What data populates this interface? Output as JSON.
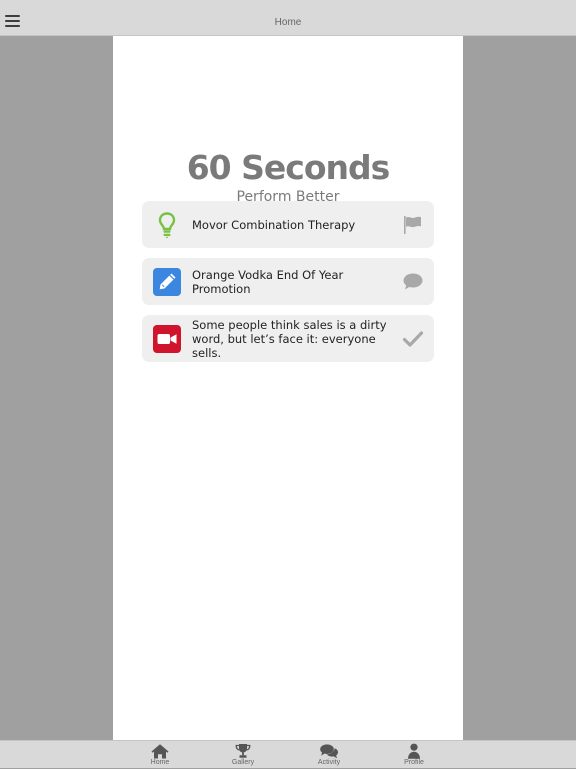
{
  "header": {
    "title": "Home",
    "menu_icon": "hamburger-menu-icon"
  },
  "brand": {
    "title": "60 Seconds",
    "subtitle": "Perform Better"
  },
  "cards": [
    {
      "text": "Movor Combination Therapy",
      "icon": "lightbulb-icon",
      "icon_color": "#7ac143",
      "action_icon": "flag-icon"
    },
    {
      "text": "Orange Vodka End Of Year Promotion",
      "icon": "pencil-icon",
      "icon_color": "#3b87e0",
      "action_icon": "comment-icon"
    },
    {
      "text": "Some people think sales is a dirty word, but let’s face it: everyone sells.",
      "icon": "video-camera-icon",
      "icon_color": "#d0142c",
      "action_icon": "checkmark-icon"
    }
  ],
  "tabbar": {
    "tabs": [
      {
        "label": "Home",
        "icon": "home-icon"
      },
      {
        "label": "Gallery",
        "icon": "trophy-icon"
      },
      {
        "label": "Activity",
        "icon": "chat-bubbles-icon"
      },
      {
        "label": "Profile",
        "icon": "person-icon"
      }
    ]
  },
  "colors": {
    "background": "#a0a0a0",
    "bar": "#d9d9d9",
    "panel": "#ffffff",
    "card": "#efefef",
    "brand_text": "#7a7a7a",
    "action_icon": "#a8a8a8"
  }
}
